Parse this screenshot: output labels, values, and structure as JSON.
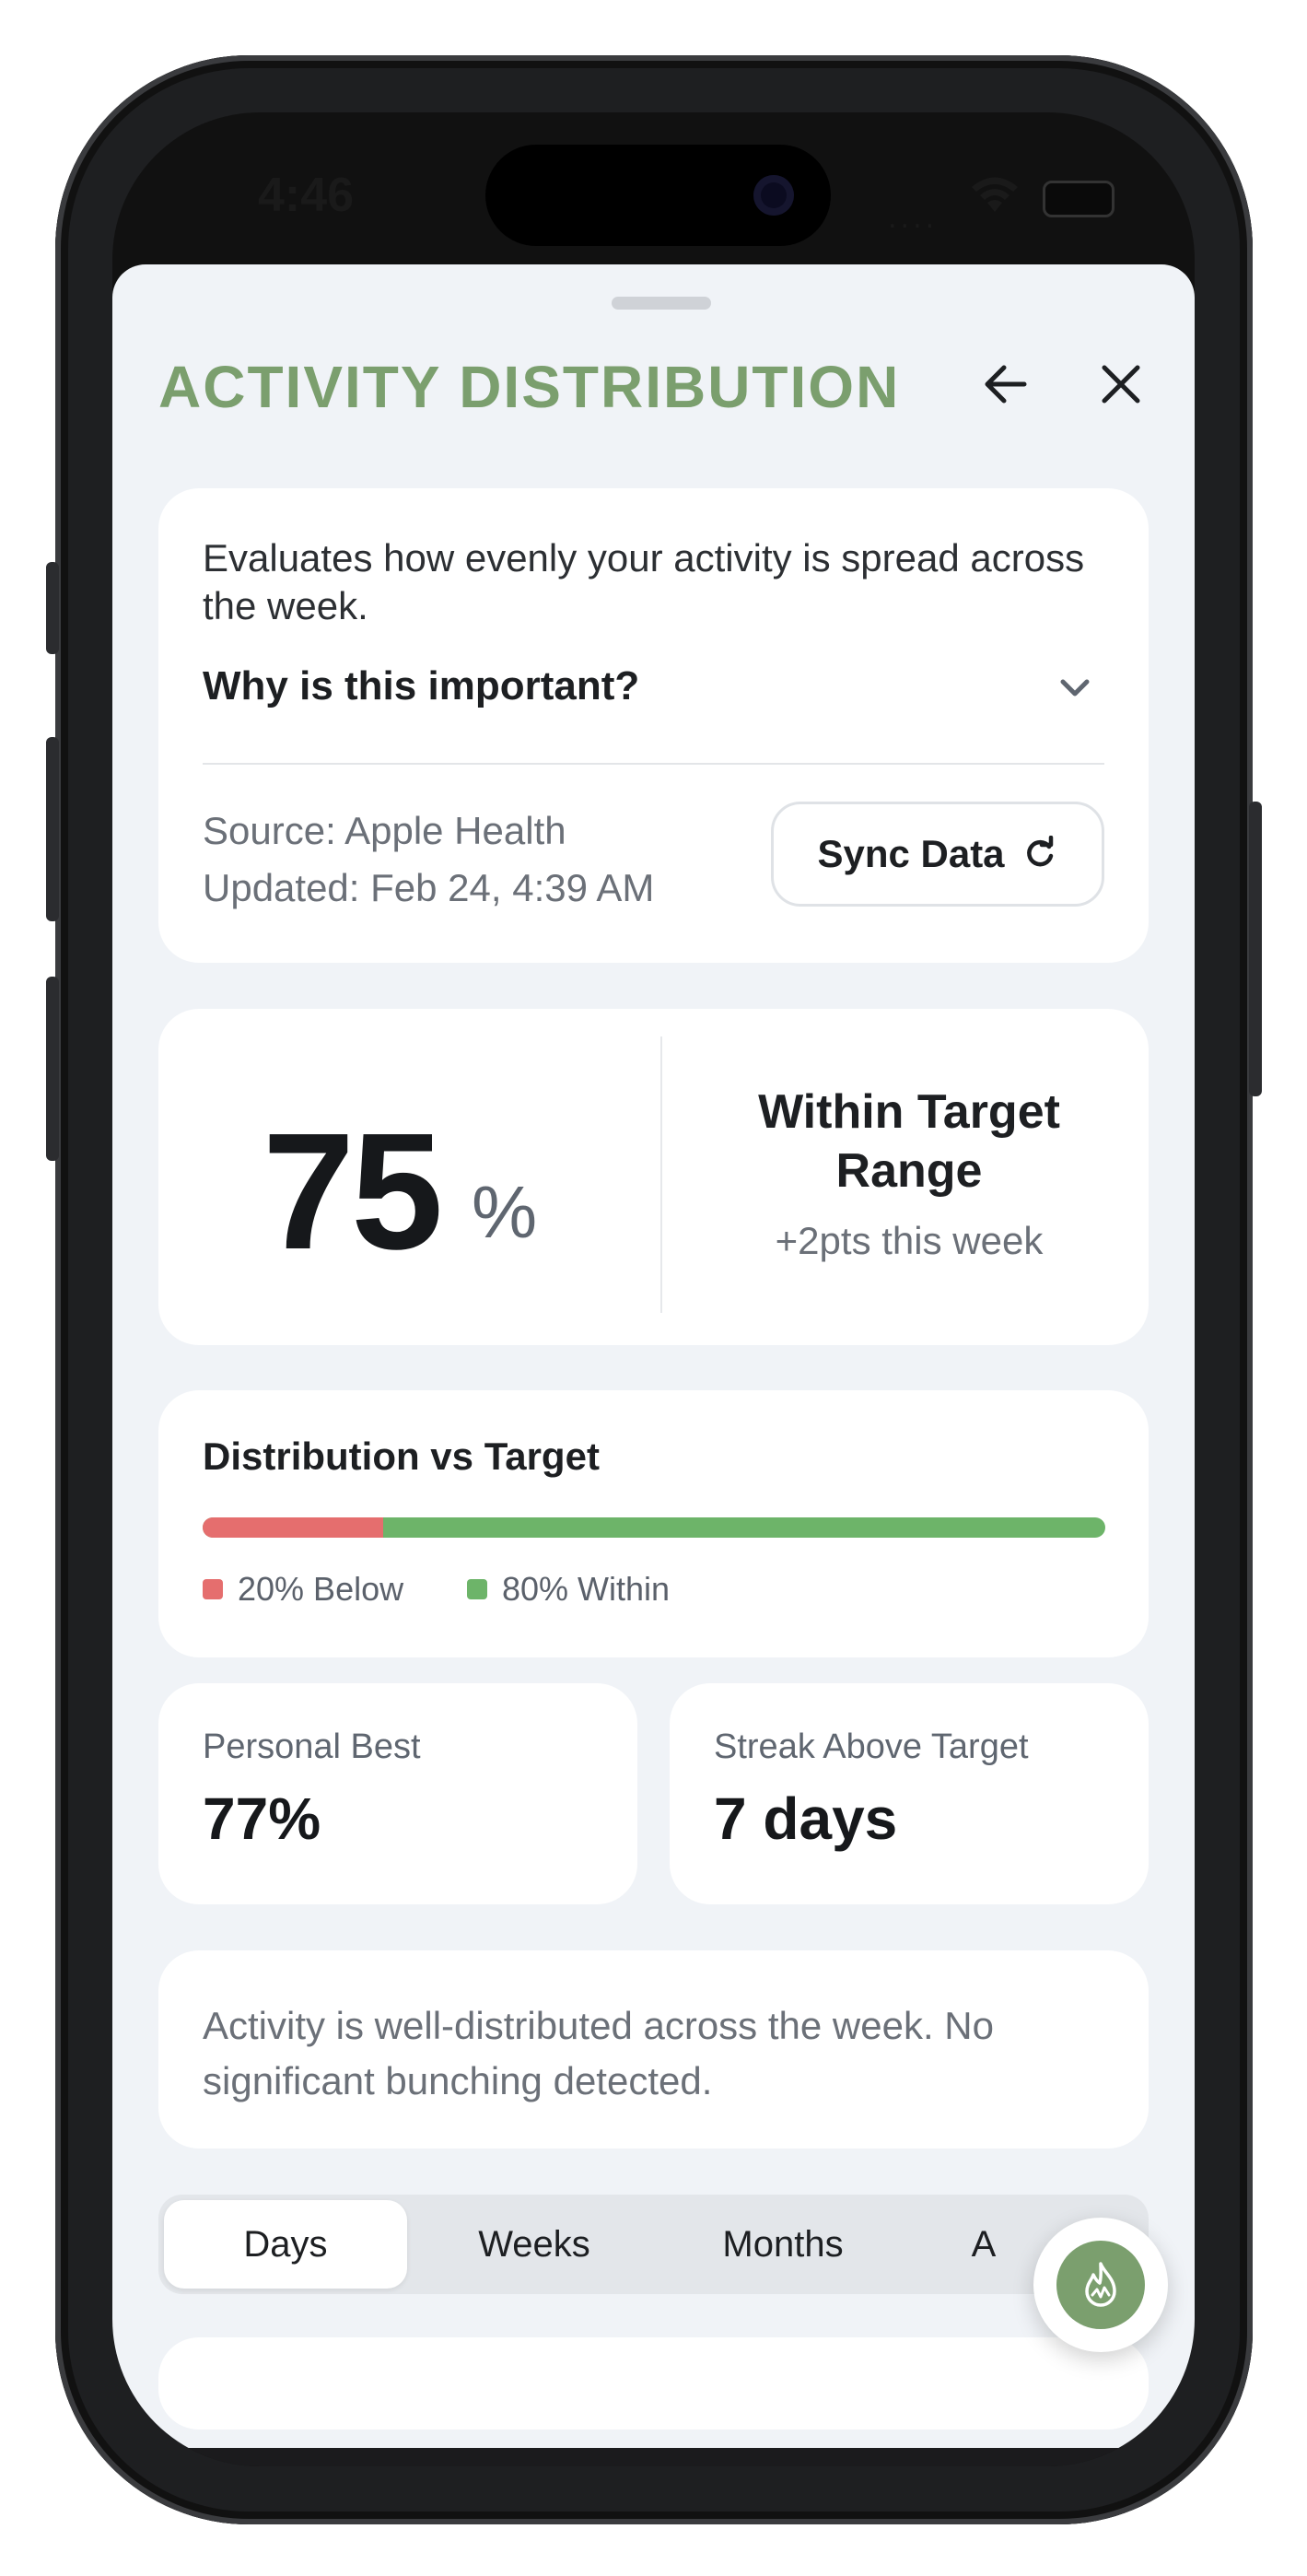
{
  "status_bar": {
    "time": "4:46",
    "signal": "....",
    "battery_icon": "battery-icon",
    "wifi_icon": "wifi-icon"
  },
  "header": {
    "title": "ACTIVITY DISTRIBUTION",
    "back_icon": "arrow-left-icon",
    "close_icon": "close-icon"
  },
  "info_card": {
    "description": "Evaluates how evenly your activity is spread across the week.",
    "why_label": "Why is this important?",
    "source": "Source: Apple Health",
    "updated": "Updated: Feb 24, 4:39 AM",
    "sync_label": "Sync Data"
  },
  "score_card": {
    "value": "75",
    "unit": "%",
    "status": "Within Target Range",
    "change": "+2pts this week"
  },
  "distribution": {
    "title": "Distribution vs Target",
    "below_fraction": 0.2,
    "below_label": "20% Below",
    "within_label": "80% Within",
    "colors": {
      "below": "#e56e6e",
      "within": "#6db469"
    }
  },
  "stats": [
    {
      "label": "Personal Best",
      "value": "77%"
    },
    {
      "label": "Streak Above Target",
      "value": "7 days"
    }
  ],
  "insight": "Activity is well-distributed across the week. No significant bunching detected.",
  "tabs": {
    "items": [
      "Days",
      "Weeks",
      "Months",
      "A"
    ],
    "active": "Days"
  },
  "fab": {
    "icon": "flame-icon"
  },
  "theme": {
    "accent": "#7b9f6e"
  }
}
